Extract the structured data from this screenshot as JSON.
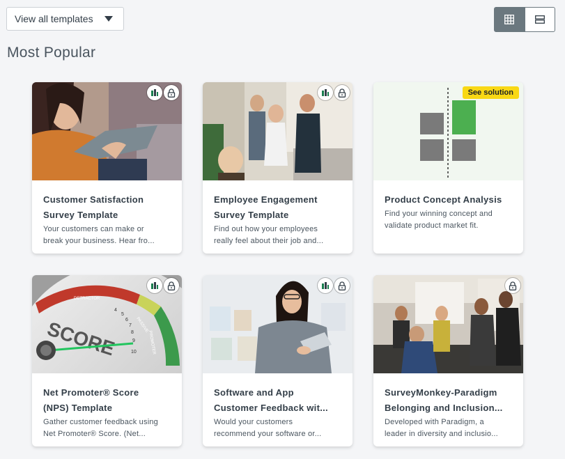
{
  "filter": {
    "label": "View all templates"
  },
  "section": {
    "title": "Most Popular"
  },
  "badge": {
    "see_solution": "See solution"
  },
  "cards": [
    {
      "title_1": "Customer Satisfaction",
      "title_2": "Survey Template",
      "desc_1": "Your customers can make or",
      "desc_2": "break your business. Hear fro..."
    },
    {
      "title_1": "Employee Engagement",
      "title_2": "Survey Template",
      "desc_1": "Find out how your employees",
      "desc_2": "really feel about their job and..."
    },
    {
      "title_1": "Product Concept Analysis",
      "title_2": "",
      "desc_1": "Find your winning concept and",
      "desc_2": "validate product market fit."
    },
    {
      "title_1": "Net Promoter® Score",
      "title_2": "(NPS) Template",
      "desc_1": "Gather customer feedback using",
      "desc_2": "Net Promoter® Score. (Net..."
    },
    {
      "title_1": "Software and App",
      "title_2": "Customer Feedback wit...",
      "desc_1": "Would your customers",
      "desc_2": "recommend your software or..."
    },
    {
      "title_1": "SurveyMonkey-Paradigm",
      "title_2": "Belonging and Inclusion...",
      "desc_1": "Developed with Paradigm, a",
      "desc_2": "leader in diversity and inclusio..."
    }
  ],
  "nps_graphic": {
    "word": "SCORE",
    "scale": [
      "4",
      "5",
      "6",
      "7",
      "8",
      "9",
      "10"
    ],
    "detractor": "DETRACTOR",
    "passive": "PASSIVE",
    "promoter": "PROMOTER"
  },
  "colors": {
    "accent_green": "#00bf6f",
    "badge_yellow": "#f9d814",
    "toggle_active": "#6b787f",
    "concept_green": "#4caf50",
    "concept_gray": "#7a7a7a"
  },
  "icons": [
    "chart-icon",
    "lock-icon",
    "grid-view-icon",
    "list-view-icon",
    "chevron-down-icon"
  ]
}
